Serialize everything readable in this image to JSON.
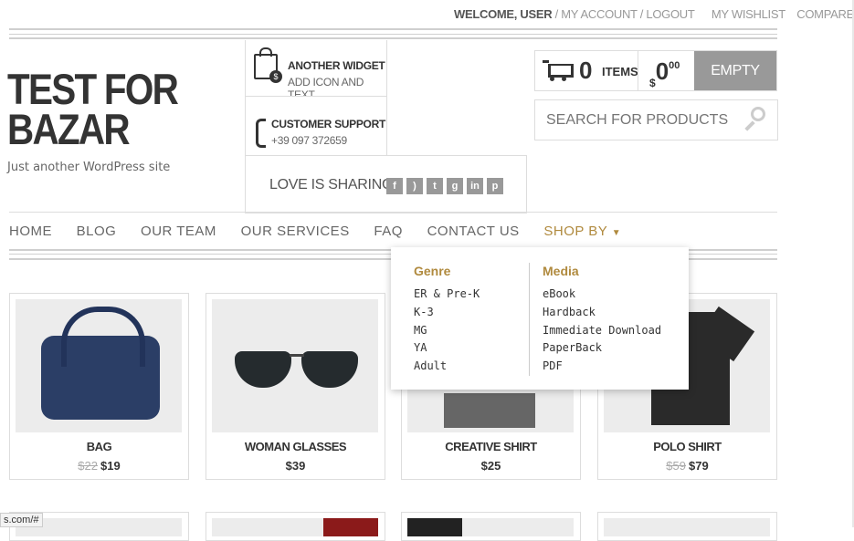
{
  "topbar": {
    "welcome": "WELCOME, USER",
    "my_account": "MY ACCOUNT",
    "logout": "LOGOUT",
    "wishlist": "MY WISHLIST",
    "compare": "COMPARE"
  },
  "site": {
    "title_line1": "TEST FOR",
    "title_line2": "BAZAR",
    "tagline": "Just another WordPress site"
  },
  "widgets": {
    "another_title": "ANOTHER WIDGET",
    "another_sub": "ADD ICON AND TEXT",
    "support_title": "CUSTOMER SUPPORT",
    "support_phone": "+39 097 372659",
    "sharing_label": "LOVE IS SHARING",
    "social_icons": [
      "facebook-icon",
      "rss-icon",
      "twitter-icon",
      "google-plus-icon",
      "linkedin-icon",
      "pinterest-icon"
    ]
  },
  "cart": {
    "count": "0",
    "items_label": "ITEMS",
    "currency": "$",
    "amount": "0",
    "cents": "00",
    "empty_label": "EMPTY CART"
  },
  "search": {
    "placeholder": "SEARCH FOR PRODUCTS"
  },
  "nav": {
    "home": "HOME",
    "blog": "BLOG",
    "team": "OUR TEAM",
    "services": "OUR SERVICES",
    "faq": "FAQ",
    "contact": "CONTACT US",
    "shop_by": "SHOP BY"
  },
  "dropdown": {
    "genre_title": "Genre",
    "genre": [
      "ER & Pre-K",
      "K-3",
      "MG",
      "YA",
      "Adult"
    ],
    "media_title": "Media",
    "media": [
      "eBook",
      "Hardback",
      "Immediate Download",
      "PaperBack",
      "PDF"
    ]
  },
  "products": [
    {
      "name": "BAG",
      "old_price": "$22",
      "price": "$19"
    },
    {
      "name": "WOMAN GLASSES",
      "old_price": "",
      "price": "$39"
    },
    {
      "name": "CREATIVE SHIRT",
      "old_price": "",
      "price": "$25"
    },
    {
      "name": "POLO SHIRT",
      "old_price": "$59",
      "price": "$79"
    }
  ],
  "status_url": "s.com/#",
  "colors": {
    "accent": "#b08a3e",
    "cart_button": "#999999"
  }
}
